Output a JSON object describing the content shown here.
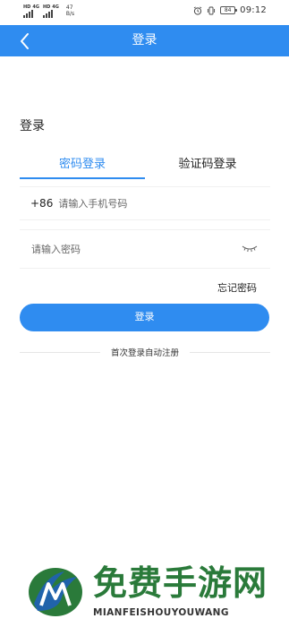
{
  "status_bar": {
    "sim1_tags": [
      "HD",
      "4G"
    ],
    "sim2_tags": [
      "HD",
      "4G"
    ],
    "net_speed_value": "47",
    "net_speed_unit": "B/s",
    "battery_level": "84",
    "time": "09:12"
  },
  "header": {
    "title": "登录",
    "back_icon": "chevron-left-icon",
    "background": "#2f8cf0"
  },
  "page": {
    "heading": "登录"
  },
  "tabs": [
    {
      "label": "密码登录",
      "active": true
    },
    {
      "label": "验证码登录",
      "active": false
    }
  ],
  "form": {
    "country_code": "+86",
    "phone_placeholder": "请输入手机号码",
    "password_placeholder": "请输入密码",
    "eye_icon": "eye-closed-icon",
    "forgot_password": "忘记密码",
    "login_button": "登录",
    "auto_register_note": "首次登录自动注册"
  },
  "watermark": {
    "title": "免费手游网",
    "subtitle": "MIANFEISHOUYOUWANG"
  },
  "colors": {
    "accent": "#2f8cf0",
    "watermark_green": "#2a7a3a"
  }
}
